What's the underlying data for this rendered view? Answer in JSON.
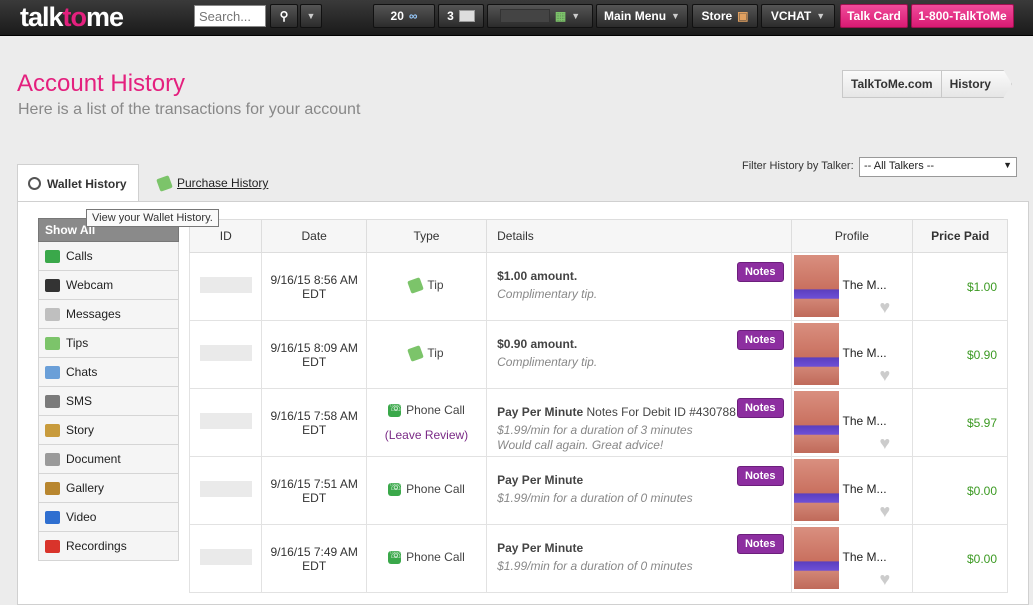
{
  "header": {
    "logo_main": "talk",
    "logo_accent": "to",
    "logo_end": "me",
    "search_placeholder": "Search...",
    "mins_count": "20",
    "msg_count": "3",
    "main_menu": "Main Menu",
    "store": "Store",
    "vchat": "VCHAT",
    "talk_card": "Talk Card",
    "phone": "1-800-TalkToMe"
  },
  "page": {
    "title": "Account History",
    "subtitle": "Here is a list of the transactions for your account",
    "breadcrumbs": [
      "TalkToMe.com",
      "History"
    ]
  },
  "tabs": {
    "wallet": "Wallet History",
    "purchase": "Purchase History",
    "tooltip": "View your Wallet History."
  },
  "filter": {
    "label": "Filter History by Talker:",
    "selected": "-- All Talkers --"
  },
  "sidebar": {
    "head": "Show All",
    "items": [
      {
        "label": "Calls",
        "icon": "phone-icon",
        "color": "#3aa84a"
      },
      {
        "label": "Webcam",
        "icon": "webcam-icon",
        "color": "#333333"
      },
      {
        "label": "Messages",
        "icon": "envelope-icon",
        "color": "#bfbfbf"
      },
      {
        "label": "Tips",
        "icon": "money-icon",
        "color": "#7cc46a"
      },
      {
        "label": "Chats",
        "icon": "chat-icon",
        "color": "#6a9fd8"
      },
      {
        "label": "SMS",
        "icon": "mobile-icon",
        "color": "#7a7a7a"
      },
      {
        "label": "Story",
        "icon": "book-icon",
        "color": "#c89b3c"
      },
      {
        "label": "Document",
        "icon": "document-icon",
        "color": "#9a9a9a"
      },
      {
        "label": "Gallery",
        "icon": "gallery-icon",
        "color": "#b8862f"
      },
      {
        "label": "Video",
        "icon": "play-icon",
        "color": "#2f6fd0"
      },
      {
        "label": "Recordings",
        "icon": "record-icon",
        "color": "#d9342b"
      }
    ]
  },
  "table": {
    "headers": [
      "ID",
      "Date",
      "Type",
      "Details",
      "Profile",
      "Price Paid"
    ],
    "notes_label": "Notes",
    "rows": [
      {
        "date": "9/16/15 8:56 AM EDT",
        "type": "Tip",
        "type_icon": "money-icon",
        "review": "",
        "title": "$1.00 amount.",
        "title_extra": "",
        "sub1": "Complimentary tip.",
        "sub2": "",
        "profile": "The M...",
        "price": "$1.00"
      },
      {
        "date": "9/16/15 8:09 AM EDT",
        "type": "Tip",
        "type_icon": "money-icon",
        "review": "",
        "title": "$0.90 amount.",
        "title_extra": "",
        "sub1": "Complimentary tip.",
        "sub2": "",
        "profile": "The M...",
        "price": "$0.90"
      },
      {
        "date": "9/16/15 7:58 AM EDT",
        "type": "Phone Call",
        "type_icon": "phone-icon",
        "review": "(Leave Review)",
        "title": "Pay Per Minute",
        "title_extra": " Notes For Debit ID #430788",
        "sub1": "$1.99/min for a duration of 3 minutes",
        "sub2": "Would call again. Great advice!",
        "profile": "The M...",
        "price": "$5.97"
      },
      {
        "date": "9/16/15 7:51 AM EDT",
        "type": "Phone Call",
        "type_icon": "phone-icon",
        "review": "",
        "title": "Pay Per Minute",
        "title_extra": "",
        "sub1": "$1.99/min for a duration of 0 minutes",
        "sub2": "",
        "profile": "The M...",
        "price": "$0.00"
      },
      {
        "date": "9/16/15 7:49 AM EDT",
        "type": "Phone Call",
        "type_icon": "phone-icon",
        "review": "",
        "title": "Pay Per Minute",
        "title_extra": "",
        "sub1": "$1.99/min for a duration of 0 minutes",
        "sub2": "",
        "profile": "The M...",
        "price": "$0.00"
      }
    ]
  }
}
